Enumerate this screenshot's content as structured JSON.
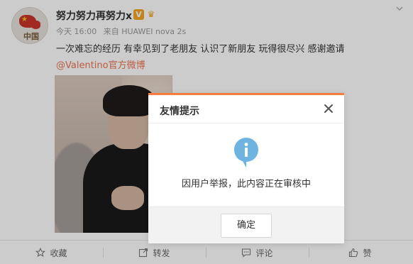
{
  "post": {
    "username": "努力努力再努力x",
    "verified_badge_glyph": "V",
    "timestamp": "今天 16:00",
    "source": "来自 HUAWEI nova 2s",
    "text": "一次难忘的经历 有幸见到了老朋友 认识了新朋友 玩得很尽兴 感谢邀请",
    "mention": "@Valentino官方微博",
    "avatar_text": "中国"
  },
  "actions": [
    {
      "label": "收藏",
      "icon": "star-icon"
    },
    {
      "label": "转发",
      "icon": "share-icon"
    },
    {
      "label": "评论",
      "icon": "comment-icon"
    },
    {
      "label": "赞",
      "icon": "like-icon"
    }
  ],
  "dialog": {
    "title": "友情提示",
    "message": "因用户举报，此内容正在审核中",
    "ok_label": "确定",
    "accent_color": "#fa7d3c",
    "info_icon_color": "#6fb3e0"
  }
}
